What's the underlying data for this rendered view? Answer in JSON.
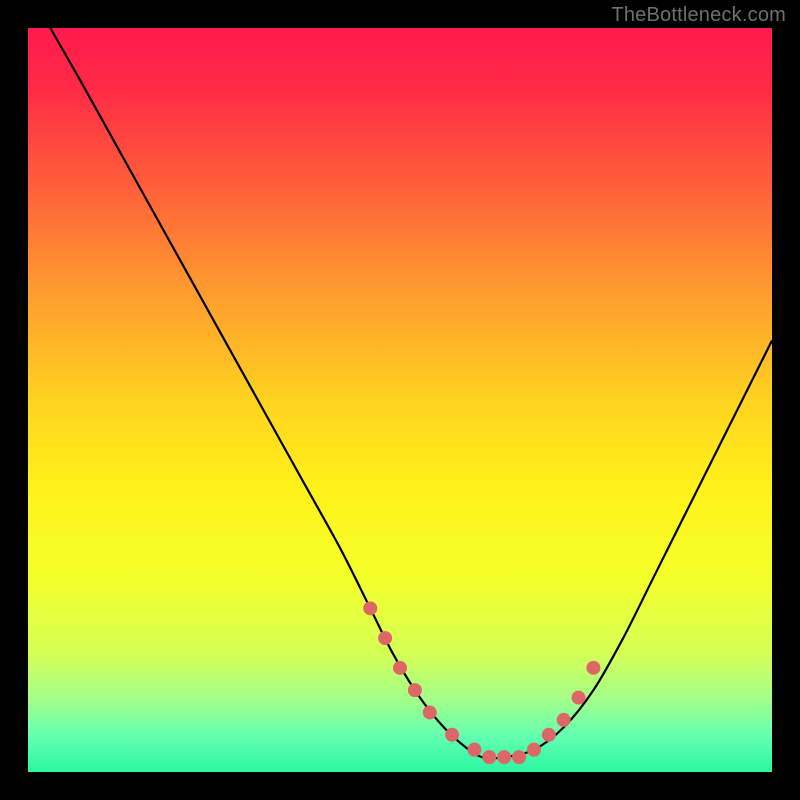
{
  "watermark": "TheBottleneck.com",
  "chart_data": {
    "type": "line",
    "title": "",
    "xlabel": "",
    "ylabel": "",
    "xlim": [
      0,
      100
    ],
    "ylim": [
      0,
      100
    ],
    "grid": false,
    "series": [
      {
        "name": "curve",
        "color": "#000000",
        "x": [
          3,
          7,
          12,
          17,
          22,
          27,
          32,
          37,
          42,
          46,
          49,
          52,
          55,
          58,
          61,
          64,
          68,
          72,
          76,
          80,
          84,
          88,
          92,
          96,
          100
        ],
        "y": [
          100,
          93,
          84,
          75,
          66,
          57,
          48,
          39,
          30,
          22,
          16,
          11,
          7,
          4,
          2,
          2,
          3,
          6,
          11,
          18,
          26,
          34,
          42,
          50,
          58
        ]
      }
    ],
    "markers": {
      "color": "#dd6666",
      "radius": 7,
      "x": [
        46,
        48,
        50,
        52,
        54,
        57,
        60,
        62,
        64,
        66,
        68,
        70,
        72,
        74,
        76
      ],
      "y": [
        22,
        18,
        14,
        11,
        8,
        5,
        3,
        2,
        2,
        2,
        3,
        5,
        7,
        10,
        14
      ]
    },
    "background_gradient": {
      "stops": [
        {
          "offset": 0.0,
          "color": "#ff1a4d"
        },
        {
          "offset": 0.08,
          "color": "#ff2a46"
        },
        {
          "offset": 0.2,
          "color": "#ff5a3b"
        },
        {
          "offset": 0.35,
          "color": "#ff9a30"
        },
        {
          "offset": 0.5,
          "color": "#ffd21f"
        },
        {
          "offset": 0.62,
          "color": "#fff21a"
        },
        {
          "offset": 0.74,
          "color": "#f4ff2a"
        },
        {
          "offset": 0.84,
          "color": "#d4ff55"
        },
        {
          "offset": 0.9,
          "color": "#a6ff88"
        },
        {
          "offset": 0.95,
          "color": "#66ffb0"
        },
        {
          "offset": 1.0,
          "color": "#2bf7a0"
        }
      ]
    }
  }
}
